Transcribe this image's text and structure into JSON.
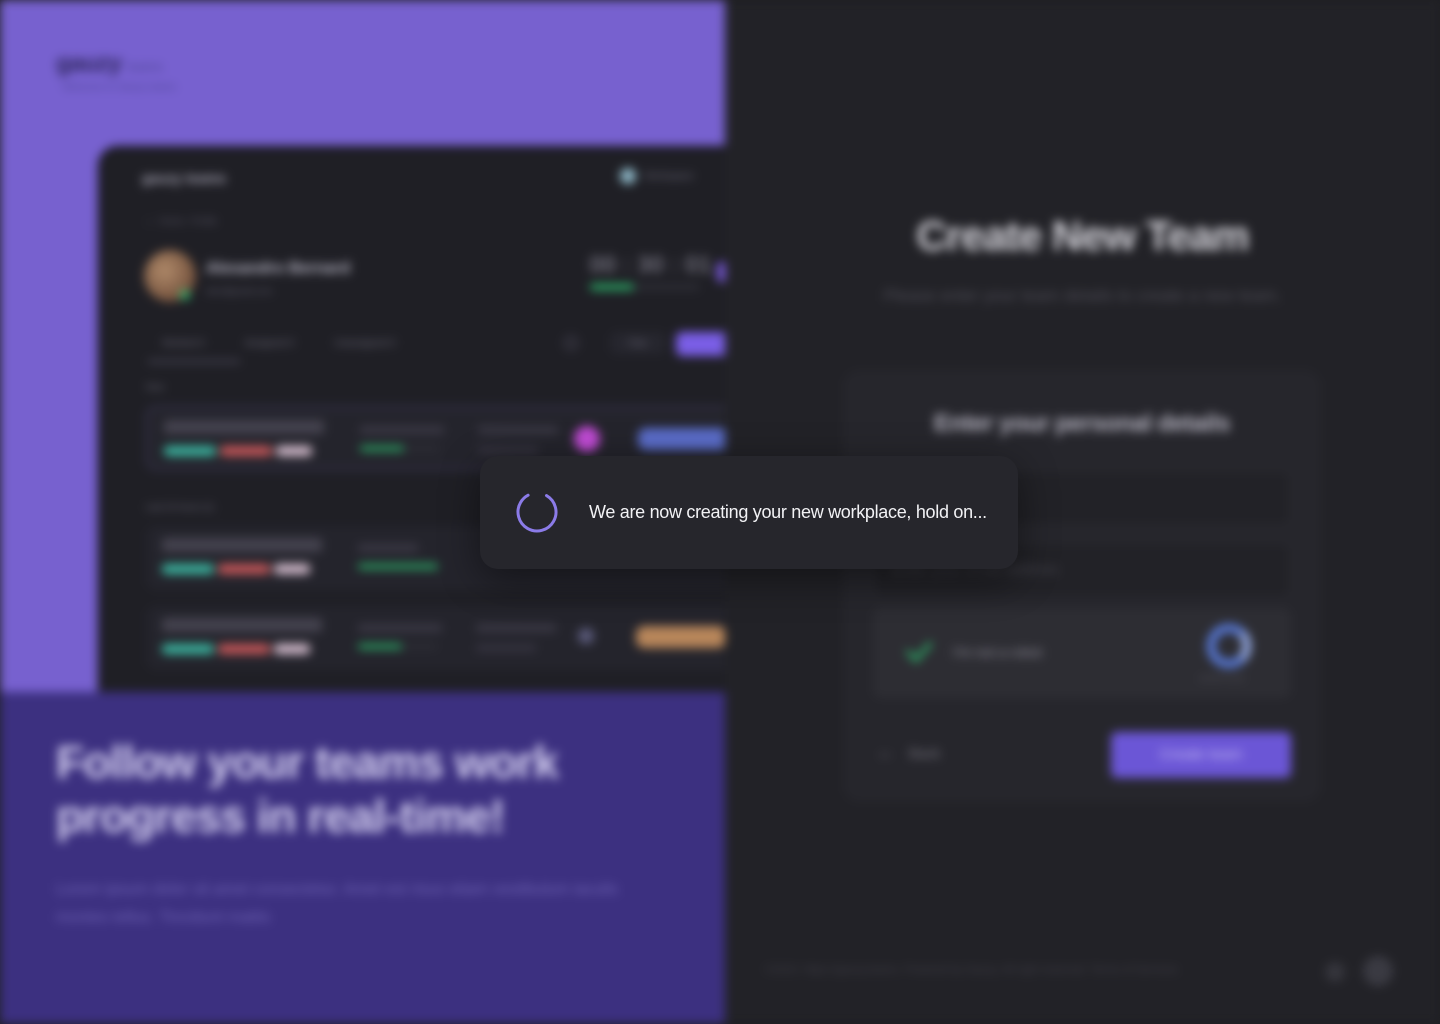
{
  "brand": {
    "name": "gauzy",
    "sub": "teams",
    "tagline": "Welcome to Gauzy teams"
  },
  "hero": {
    "title": "Follow your teams work progress in real-time!",
    "description": "Lorem ipsum dolor sit amet consectetur. Amet est risus etiam vestibulum iaculis montes tellus. Tincidunt mattis"
  },
  "mock": {
    "logo": "gauzy teams",
    "workspace": "Workspace",
    "breadcrumb": "⌂  ·  Home  ›  Profile",
    "user_name": "Alexandro Bernard",
    "user_email": "alex@gmail.com",
    "timer": "00 : 30 : 01",
    "tabs": [
      "Worked 0",
      "Assigned 0",
      "Unassigned 0"
    ],
    "filter_label": "Filter",
    "section_now": "Now",
    "section_last": "Last 24 hours (1)"
  },
  "right": {
    "title": "Create New Team",
    "subtitle": "Please enter your team details to create a new team.",
    "form_heading": "Enter your personal details",
    "email_placeholder": "Enter your email address",
    "captcha_label": "I'm not a robot",
    "captcha_brand": "reCAPTCHA",
    "back_label": "Back",
    "create_label": "Create team",
    "footer": "©2023. https://gauzy.teams. Powered by Gauzy. All right reserved. Terms of Services"
  },
  "loader": {
    "message": "We are now creating your new workplace, hold on..."
  },
  "colors": {
    "accent": "#7761cf",
    "spinner": "#8b7be8",
    "dialog_bg": "#26262c"
  }
}
